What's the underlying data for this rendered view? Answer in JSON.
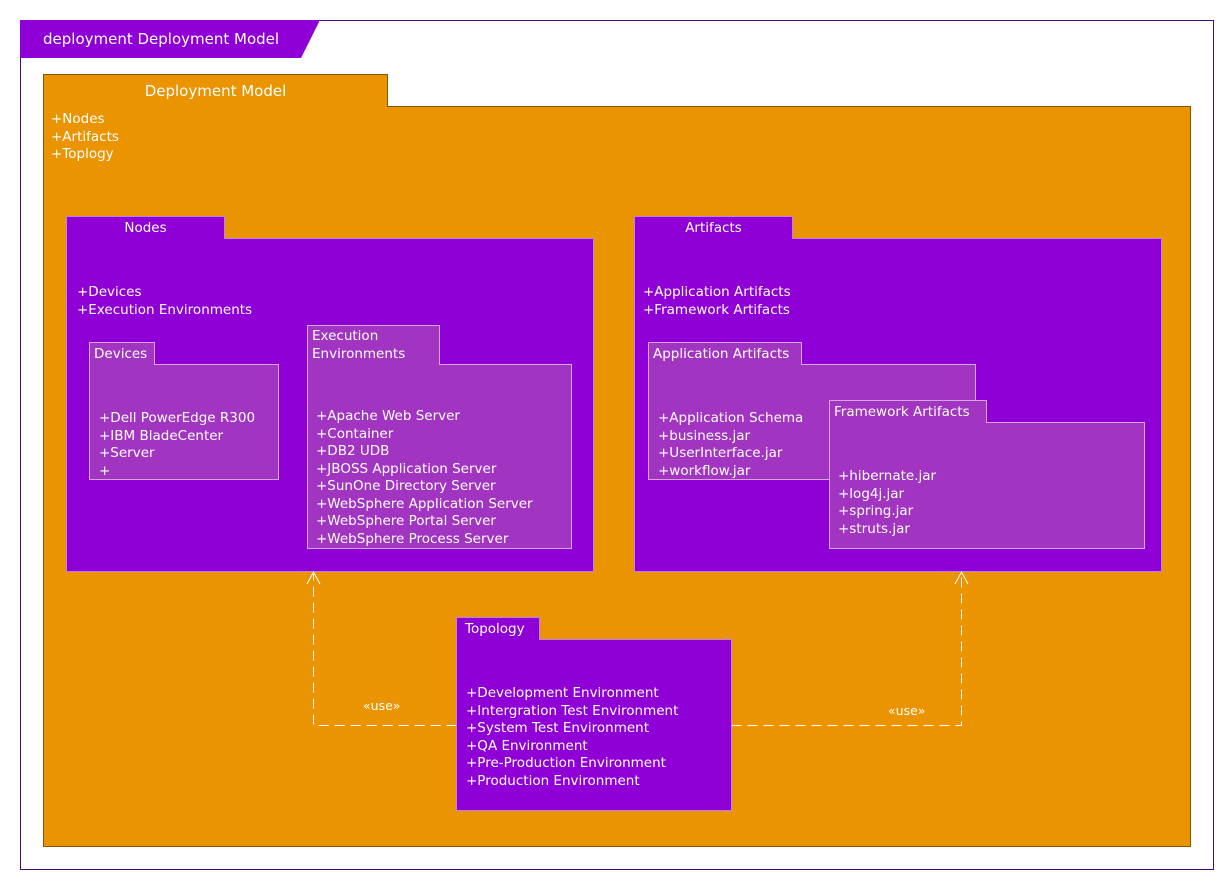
{
  "diagram": {
    "frame_title": "deployment Deployment Model",
    "colors": {
      "frame_border": "#4b0a6e",
      "package_outer": "#e99400",
      "package_primary": "#8e00d6",
      "package_nested": "#a234c2",
      "text": "#ffffff"
    },
    "root_package": {
      "name": "Deployment Model",
      "members": [
        "+Nodes",
        "+Artifacts",
        "+Toplogy"
      ]
    },
    "nodes": {
      "name": "Nodes",
      "members": [
        "+Devices",
        "+Execution Environments"
      ],
      "devices": {
        "name": "Devices",
        "members": [
          "+Dell PowerEdge R300",
          "+IBM BladeCenter",
          "+Server",
          "+"
        ]
      },
      "execution_environments": {
        "name_line1": "Execution",
        "name_line2": "Environments",
        "members": [
          "+Apache Web Server",
          "+Container",
          "+DB2 UDB",
          "+JBOSS Application Server",
          "+SunOne Directory Server",
          "+WebSphere Application Server",
          "+WebSphere Portal Server",
          "+WebSphere Process Server"
        ]
      }
    },
    "artifacts": {
      "name": "Artifacts",
      "members": [
        "+Application Artifacts",
        "+Framework Artifacts"
      ],
      "application_artifacts": {
        "name": "Application Artifacts",
        "members": [
          "+Application Schema",
          "+business.jar",
          "+UserInterface.jar",
          "+workflow.jar"
        ]
      },
      "framework_artifacts": {
        "name": "Framework Artifacts",
        "members": [
          "+hibernate.jar",
          "+log4j.jar",
          "+spring.jar",
          "+struts.jar"
        ]
      }
    },
    "topology": {
      "name": "Topology",
      "members": [
        "+Development Environment",
        "+Intergration Test Environment",
        "+System Test Environment",
        "+QA Environment",
        "+Pre-Production Environment",
        "+Production Environment"
      ]
    },
    "relationships": [
      {
        "from": "Topology",
        "to": "Nodes",
        "stereotype": "«use»",
        "style": "dashed-open-arrow"
      },
      {
        "from": "Topology",
        "to": "Artifacts",
        "stereotype": "«use»",
        "style": "dashed-open-arrow"
      }
    ]
  }
}
